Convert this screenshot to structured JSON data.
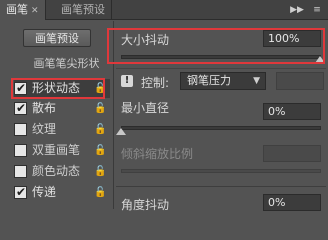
{
  "tabs": [
    {
      "label": "画笔",
      "close": "✕"
    },
    {
      "label": "画笔预设"
    }
  ],
  "toolbar_icons": [
    "double-arrow-icon",
    "menu-icon"
  ],
  "left_panel": {
    "preset_button": "画笔预设",
    "section_header": "画笔笔尖形状",
    "items": [
      {
        "label": "形状动态",
        "checked": true,
        "selected": true
      },
      {
        "label": "散布",
        "checked": true
      },
      {
        "label": "纹理",
        "checked": false
      },
      {
        "label": "双重画笔",
        "checked": false
      },
      {
        "label": "颜色动态",
        "checked": false
      },
      {
        "label": "传递",
        "checked": true
      }
    ]
  },
  "right_panel": {
    "size_jitter": {
      "label": "大小抖动",
      "value": "100%",
      "slider_fraction": 1.0
    },
    "control": {
      "label": "控制:",
      "selected": "钢笔压力"
    },
    "min_diameter": {
      "label": "最小直径",
      "value": "0%",
      "slider_fraction": 0.0
    },
    "tilt_scale": {
      "label": "倾斜缩放比例",
      "value": ""
    },
    "angle_jitter": {
      "label": "角度抖动",
      "value": "0%"
    }
  },
  "colors": {
    "highlight": "#e0383b",
    "panel_bg": "#535353"
  }
}
